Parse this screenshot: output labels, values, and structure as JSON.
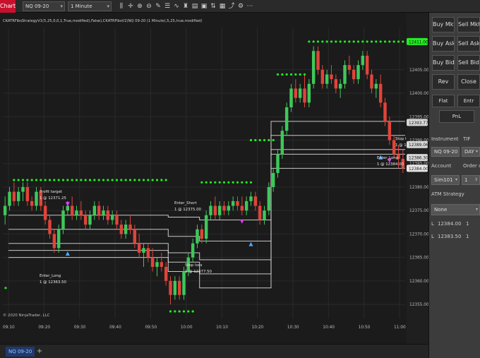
{
  "app": {
    "title": "Chart"
  },
  "toolbar": {
    "instrument": "NQ 09-20",
    "interval": "1 Minute",
    "icons": [
      "bar-style-icon",
      "crosshair-icon",
      "zoom-in-icon",
      "zoom-out-icon",
      "drawing-tools-icon",
      "properties-icon",
      "indicators-icon",
      "strategies-icon",
      "templates-icon",
      "screenshot-icon",
      "chart-trader-icon",
      "data-box-icon",
      "share-icon",
      "settings-icon",
      "more-icon"
    ]
  },
  "chart": {
    "indicator_label": "CKATRFibsStrategyV1(5,25,0,0,1,True,modified),False),CKATRFibsV2(NQ 09-20 (1 Minute),5,25,true,modified)",
    "copyright": "© 2020 NinjaTrader, LLC",
    "annotations": [
      "Profit target",
      "1 @ 12371.25",
      "Enter_Long",
      "1 @ 12363.50",
      "Enter_Short",
      "1 @ 12375.00",
      "Stop loss",
      "1 @ 12377.50",
      "Enter_Long",
      "1 @ 12384.00",
      "Stop lo",
      "1 @ 127"
    ],
    "colors": {
      "up": "#3ec85a",
      "down": "#e0443a",
      "trail": "#22ee22",
      "fib": "#e6e6e6",
      "short_arrow": "#e040ff",
      "long_arrow": "#4aa8ff"
    }
  },
  "chart_data": {
    "type": "candlestick",
    "title": "",
    "xlabel": "",
    "ylabel": "",
    "x_ticks": [
      "09:10",
      "09:20",
      "09:30",
      "09:40",
      "09:50",
      "10:00",
      "10:10",
      "10:20",
      "10:30",
      "10:40",
      "10:50",
      "11:00"
    ],
    "y_ticks": [
      12355.0,
      12360.0,
      12365.0,
      12370.0,
      12375.0,
      12380.0,
      12385.0,
      12390.0,
      12395.0,
      12400.0,
      12405.0
    ],
    "ylim": [
      12352,
      12414
    ],
    "price_tags": [
      {
        "value": "12411.00",
        "kind": "trail"
      },
      {
        "value": "12393.77",
        "kind": "fib"
      },
      {
        "value": "12389.06",
        "kind": "fib"
      },
      {
        "value": "12386.30",
        "kind": "fib"
      },
      {
        "value": "12384.00",
        "kind": "last"
      }
    ],
    "candles": [
      [
        12374,
        12378,
        12372,
        12376
      ],
      [
        12376,
        12380,
        12375,
        12379
      ],
      [
        12379,
        12381,
        12376,
        12377
      ],
      [
        12377,
        12380,
        12376,
        12379
      ],
      [
        12379,
        12381,
        12377,
        12380
      ],
      [
        12380,
        12381,
        12376,
        12377
      ],
      [
        12377,
        12378,
        12375,
        12376
      ],
      [
        12376,
        12380,
        12375,
        12379
      ],
      [
        12379,
        12380,
        12375,
        12376
      ],
      [
        12376,
        12377,
        12372,
        12373
      ],
      [
        12373,
        12374,
        12369,
        12370
      ],
      [
        12370,
        12371,
        12366,
        12367
      ],
      [
        12367,
        12372,
        12366,
        12371
      ],
      [
        12371,
        12376,
        12370,
        12375
      ],
      [
        12375,
        12377,
        12374,
        12376
      ],
      [
        12376,
        12378,
        12373,
        12374
      ],
      [
        12374,
        12376,
        12373,
        12375
      ],
      [
        12375,
        12377,
        12373,
        12374
      ],
      [
        12374,
        12375,
        12371,
        12372
      ],
      [
        12372,
        12375,
        12371,
        12374
      ],
      [
        12374,
        12377,
        12373,
        12376
      ],
      [
        12376,
        12377,
        12373,
        12374
      ],
      [
        12374,
        12376,
        12373,
        12375
      ],
      [
        12375,
        12376,
        12372,
        12373
      ],
      [
        12373,
        12375,
        12372,
        12374
      ],
      [
        12374,
        12375,
        12371,
        12372
      ],
      [
        12372,
        12373,
        12369,
        12370
      ],
      [
        12370,
        12373,
        12369,
        12372
      ],
      [
        12372,
        12374,
        12370,
        12371
      ],
      [
        12371,
        12372,
        12367,
        12368
      ],
      [
        12368,
        12370,
        12365,
        12366
      ],
      [
        12366,
        12368,
        12363,
        12367
      ],
      [
        12367,
        12368,
        12364,
        12365
      ],
      [
        12365,
        12367,
        12362,
        12363
      ],
      [
        12363,
        12365,
        12361,
        12364
      ],
      [
        12364,
        12366,
        12362,
        12363
      ],
      [
        12363,
        12364,
        12359,
        12360
      ],
      [
        12360,
        12361,
        12355,
        12357
      ],
      [
        12357,
        12361,
        12356,
        12360
      ],
      [
        12360,
        12361,
        12356,
        12357
      ],
      [
        12357,
        12363,
        12356,
        12362
      ],
      [
        12362,
        12366,
        12361,
        12365
      ],
      [
        12365,
        12369,
        12364,
        12368
      ],
      [
        12368,
        12372,
        12367,
        12371
      ],
      [
        12371,
        12372,
        12368,
        12369
      ],
      [
        12369,
        12375,
        12368,
        12374
      ],
      [
        12374,
        12377,
        12373,
        12376
      ],
      [
        12376,
        12378,
        12373,
        12374
      ],
      [
        12374,
        12377,
        12373,
        12376
      ],
      [
        12376,
        12377,
        12374,
        12375
      ],
      [
        12375,
        12377,
        12374,
        12376
      ],
      [
        12376,
        12378,
        12375,
        12377
      ],
      [
        12377,
        12378,
        12375,
        12376
      ],
      [
        12376,
        12378,
        12374,
        12375
      ],
      [
        12375,
        12378,
        12374,
        12377
      ],
      [
        12377,
        12379,
        12376,
        12378
      ],
      [
        12378,
        12379,
        12375,
        12376
      ],
      [
        12376,
        12377,
        12372,
        12373
      ],
      [
        12373,
        12376,
        12372,
        12375
      ],
      [
        12375,
        12381,
        12374,
        12380
      ],
      [
        12380,
        12384,
        12379,
        12383
      ],
      [
        12383,
        12388,
        12382,
        12387
      ],
      [
        12387,
        12393,
        12386,
        12392
      ],
      [
        12392,
        12398,
        12391,
        12397
      ],
      [
        12397,
        12402,
        12396,
        12401
      ],
      [
        12401,
        12403,
        12398,
        12399
      ],
      [
        12399,
        12402,
        12398,
        12401
      ],
      [
        12401,
        12404,
        12397,
        12398
      ],
      [
        12398,
        12403,
        12397,
        12402
      ],
      [
        12402,
        12410,
        12401,
        12409
      ],
      [
        12409,
        12410,
        12404,
        12405
      ],
      [
        12405,
        12406,
        12401,
        12402
      ],
      [
        12402,
        12405,
        12401,
        12404
      ],
      [
        12404,
        12406,
        12402,
        12403
      ],
      [
        12403,
        12404,
        12400,
        12401
      ],
      [
        12401,
        12403,
        12399,
        12402
      ],
      [
        12402,
        12407,
        12401,
        12406
      ],
      [
        12406,
        12408,
        12404,
        12405
      ],
      [
        12405,
        12406,
        12402,
        12403
      ],
      [
        12403,
        12407,
        12402,
        12406
      ],
      [
        12406,
        12409,
        12405,
        12408
      ],
      [
        12408,
        12409,
        12403,
        12404
      ],
      [
        12404,
        12405,
        12400,
        12401
      ],
      [
        12401,
        12403,
        12399,
        12402
      ],
      [
        12402,
        12404,
        12397,
        12398
      ],
      [
        12398,
        12399,
        12393,
        12394
      ],
      [
        12394,
        12395,
        12389,
        12390
      ],
      [
        12390,
        12391,
        12386,
        12387
      ],
      [
        12387,
        12389,
        12384,
        12386
      ],
      [
        12386,
        12388,
        12383,
        12384
      ]
    ],
    "trail_segments": [
      {
        "from": 2,
        "to": 36,
        "value": 12381.5
      },
      {
        "from": 37,
        "to": 42,
        "value": 12353.5
      },
      {
        "from": 44,
        "to": 55,
        "value": 12381.0
      },
      {
        "from": 55,
        "to": 60,
        "value": 12390.0
      },
      {
        "from": 61,
        "to": 67,
        "value": 12404.0
      },
      {
        "from": 68,
        "to": 89,
        "value": 12411.0
      }
    ],
    "fib_levels": [
      [
        12374.0,
        12373.6,
        12373.0,
        12384.0
      ],
      [
        12371.0,
        12369.5,
        12368.5,
        12387.0
      ],
      [
        12368.0,
        12366.0,
        12364.5,
        12391.0
      ],
      [
        12366.5,
        12364.0,
        12361.5,
        12394.0
      ],
      [
        12365.0,
        12362.0,
        12358.5,
        12388.0
      ]
    ]
  },
  "panel": {
    "buttons": [
      "Buy Mkt",
      "Sell Mkt",
      "Buy Ask",
      "Sell Ask",
      "Buy Bid",
      "Sell Bid",
      "Rev",
      "Close"
    ],
    "flat": "Flat",
    "entry": "Entr",
    "pnl": "PnL",
    "instrument_label": "Instrument",
    "tif_label": "TIF",
    "instrument_value": "NQ 09-20",
    "tif_value": "DAY",
    "account_label": "Account",
    "order_qty_label": "Order qty",
    "account_value": "Sim101",
    "order_qty_value": "1",
    "atm_label": "ATM Strategy",
    "atm_value": "None",
    "rows": [
      {
        "label": "L",
        "price": "12384.00",
        "qty": "1"
      },
      {
        "label": "L",
        "price": "12383.50",
        "qty": "1"
      }
    ]
  },
  "bottom": {
    "tab": "NQ 09-20",
    "add": "+"
  }
}
